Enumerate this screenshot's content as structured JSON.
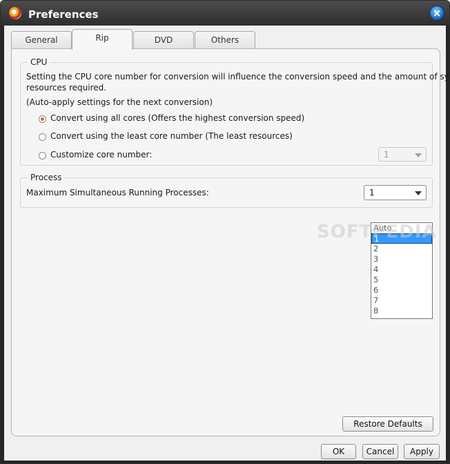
{
  "window": {
    "title": "Preferences"
  },
  "tabs": [
    {
      "label": "General",
      "active": false
    },
    {
      "label": "Rip",
      "active": true
    },
    {
      "label": "DVD",
      "active": false
    },
    {
      "label": "Others",
      "active": false
    }
  ],
  "cpu": {
    "title": "CPU",
    "description_line1": "Setting the CPU core number for conversion will influence the conversion speed and the amount of system",
    "description_line2": "resources required.",
    "note": "(Auto-apply settings for the next conversion)",
    "options": [
      {
        "label": "Convert using all cores (Offers the highest conversion speed)",
        "checked": true
      },
      {
        "label": "Convert using the least core number (The least resources)",
        "checked": false
      },
      {
        "label": "Customize core number:",
        "checked": false
      }
    ],
    "core_value": "1"
  },
  "process": {
    "title": "Process",
    "label": "Maximum Simultaneous Running Processes:",
    "value": "1",
    "dropdown_options": [
      "Auto",
      "1",
      "2",
      "3",
      "4",
      "5",
      "6",
      "7",
      "8"
    ],
    "selected_index": 1
  },
  "watermark": "SOFTPEDIA",
  "buttons": {
    "restore": "Restore Defaults",
    "ok": "OK",
    "cancel": "Cancel",
    "apply": "Apply"
  }
}
